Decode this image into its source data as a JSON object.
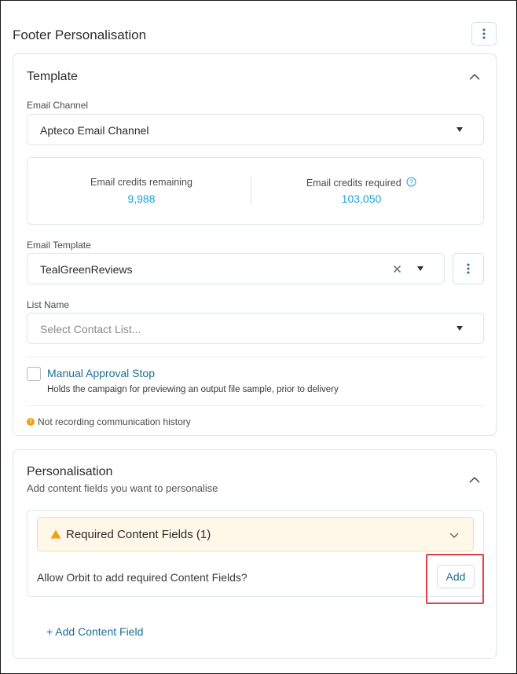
{
  "page": {
    "title": "Footer Personalisation",
    "menu_icon": "vertical-dots-icon"
  },
  "template_card": {
    "title": "Template",
    "collapse_icon": "chevron-up-icon",
    "email_channel": {
      "label": "Email Channel",
      "value": "Apteco Email Channel"
    },
    "credits": {
      "remaining_label": "Email credits remaining",
      "remaining_value": "9,988",
      "required_label": "Email credits required",
      "required_value": "103,050",
      "help_icon": "question-circle-icon"
    },
    "email_template": {
      "label": "Email Template",
      "value": "TealGreenReviews",
      "clear_icon": "close-icon"
    },
    "list_name": {
      "label": "List Name",
      "placeholder": "Select Contact List..."
    },
    "manual_approval": {
      "label": "Manual Approval Stop",
      "description": "Holds the campaign for previewing an output file sample, prior to delivery",
      "checked": false
    },
    "history_notice": "Not recording communication history"
  },
  "personalisation_card": {
    "title": "Personalisation",
    "subtitle": "Add content fields you want to personalise",
    "required_fields": {
      "title": "Required Content Fields (1)",
      "warning_icon": "warning-triangle-icon",
      "expand_icon": "chevron-down-icon"
    },
    "allow_prompt": "Allow Orbit to add required Content Fields?",
    "add_button": "Add",
    "add_content_field_link": "+ Add Content Field"
  },
  "colors": {
    "accent": "#1d6f93",
    "credit_value": "#1aa3d6",
    "warning": "#f2a10a",
    "highlight": "#e0414a"
  }
}
